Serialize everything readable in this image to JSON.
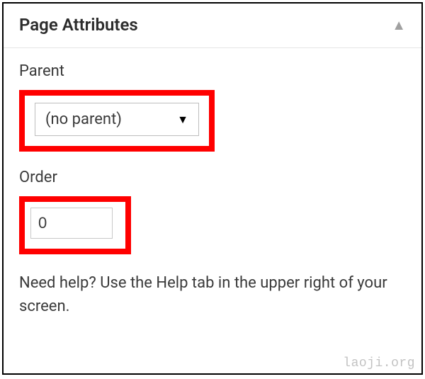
{
  "panel": {
    "title": "Page Attributes",
    "collapse_icon": "▲"
  },
  "parent": {
    "label": "Parent",
    "selected": "(no parent)",
    "arrow": "▼"
  },
  "order": {
    "label": "Order",
    "value": "0"
  },
  "help_text": "Need help? Use the Help tab in the upper right of your screen.",
  "watermark": "laoji.org"
}
